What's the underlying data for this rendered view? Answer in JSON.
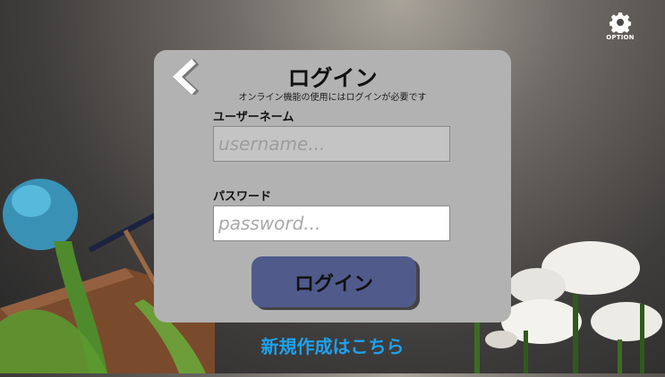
{
  "option": {
    "label": "OPTION",
    "icon": "gear-icon"
  },
  "dialog": {
    "back_icon": "chevron-left-icon",
    "title": "ログイン",
    "subtitle": "オンライン機能の使用にはログインが必要です",
    "username_label": "ユーザーネーム",
    "username_placeholder": "username...",
    "password_label": "パスワード",
    "password_placeholder": "password...",
    "login_button": "ログイン"
  },
  "register_link": "新規作成はこちら",
  "colors": {
    "dialog_bg": "#b2b2b2",
    "button_bg": "#505a8b",
    "link": "#1ea2ef"
  }
}
